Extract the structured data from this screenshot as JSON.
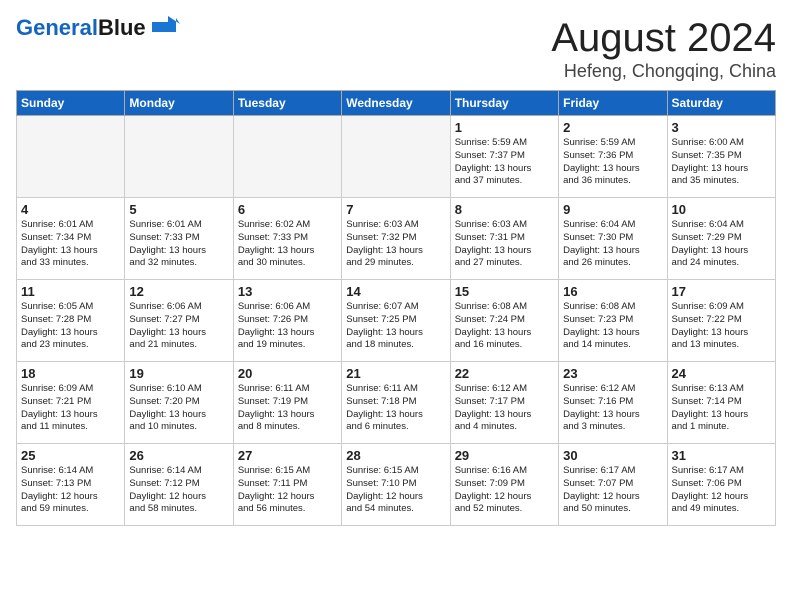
{
  "header": {
    "logo_line1": "General",
    "logo_line2": "Blue",
    "month": "August 2024",
    "location": "Hefeng, Chongqing, China"
  },
  "days_of_week": [
    "Sunday",
    "Monday",
    "Tuesday",
    "Wednesday",
    "Thursday",
    "Friday",
    "Saturday"
  ],
  "weeks": [
    [
      {
        "day": "",
        "content": ""
      },
      {
        "day": "",
        "content": ""
      },
      {
        "day": "",
        "content": ""
      },
      {
        "day": "",
        "content": ""
      },
      {
        "day": "1",
        "content": "Sunrise: 5:59 AM\nSunset: 7:37 PM\nDaylight: 13 hours\nand 37 minutes."
      },
      {
        "day": "2",
        "content": "Sunrise: 5:59 AM\nSunset: 7:36 PM\nDaylight: 13 hours\nand 36 minutes."
      },
      {
        "day": "3",
        "content": "Sunrise: 6:00 AM\nSunset: 7:35 PM\nDaylight: 13 hours\nand 35 minutes."
      }
    ],
    [
      {
        "day": "4",
        "content": "Sunrise: 6:01 AM\nSunset: 7:34 PM\nDaylight: 13 hours\nand 33 minutes."
      },
      {
        "day": "5",
        "content": "Sunrise: 6:01 AM\nSunset: 7:33 PM\nDaylight: 13 hours\nand 32 minutes."
      },
      {
        "day": "6",
        "content": "Sunrise: 6:02 AM\nSunset: 7:33 PM\nDaylight: 13 hours\nand 30 minutes."
      },
      {
        "day": "7",
        "content": "Sunrise: 6:03 AM\nSunset: 7:32 PM\nDaylight: 13 hours\nand 29 minutes."
      },
      {
        "day": "8",
        "content": "Sunrise: 6:03 AM\nSunset: 7:31 PM\nDaylight: 13 hours\nand 27 minutes."
      },
      {
        "day": "9",
        "content": "Sunrise: 6:04 AM\nSunset: 7:30 PM\nDaylight: 13 hours\nand 26 minutes."
      },
      {
        "day": "10",
        "content": "Sunrise: 6:04 AM\nSunset: 7:29 PM\nDaylight: 13 hours\nand 24 minutes."
      }
    ],
    [
      {
        "day": "11",
        "content": "Sunrise: 6:05 AM\nSunset: 7:28 PM\nDaylight: 13 hours\nand 23 minutes."
      },
      {
        "day": "12",
        "content": "Sunrise: 6:06 AM\nSunset: 7:27 PM\nDaylight: 13 hours\nand 21 minutes."
      },
      {
        "day": "13",
        "content": "Sunrise: 6:06 AM\nSunset: 7:26 PM\nDaylight: 13 hours\nand 19 minutes."
      },
      {
        "day": "14",
        "content": "Sunrise: 6:07 AM\nSunset: 7:25 PM\nDaylight: 13 hours\nand 18 minutes."
      },
      {
        "day": "15",
        "content": "Sunrise: 6:08 AM\nSunset: 7:24 PM\nDaylight: 13 hours\nand 16 minutes."
      },
      {
        "day": "16",
        "content": "Sunrise: 6:08 AM\nSunset: 7:23 PM\nDaylight: 13 hours\nand 14 minutes."
      },
      {
        "day": "17",
        "content": "Sunrise: 6:09 AM\nSunset: 7:22 PM\nDaylight: 13 hours\nand 13 minutes."
      }
    ],
    [
      {
        "day": "18",
        "content": "Sunrise: 6:09 AM\nSunset: 7:21 PM\nDaylight: 13 hours\nand 11 minutes."
      },
      {
        "day": "19",
        "content": "Sunrise: 6:10 AM\nSunset: 7:20 PM\nDaylight: 13 hours\nand 10 minutes."
      },
      {
        "day": "20",
        "content": "Sunrise: 6:11 AM\nSunset: 7:19 PM\nDaylight: 13 hours\nand 8 minutes."
      },
      {
        "day": "21",
        "content": "Sunrise: 6:11 AM\nSunset: 7:18 PM\nDaylight: 13 hours\nand 6 minutes."
      },
      {
        "day": "22",
        "content": "Sunrise: 6:12 AM\nSunset: 7:17 PM\nDaylight: 13 hours\nand 4 minutes."
      },
      {
        "day": "23",
        "content": "Sunrise: 6:12 AM\nSunset: 7:16 PM\nDaylight: 13 hours\nand 3 minutes."
      },
      {
        "day": "24",
        "content": "Sunrise: 6:13 AM\nSunset: 7:14 PM\nDaylight: 13 hours\nand 1 minute."
      }
    ],
    [
      {
        "day": "25",
        "content": "Sunrise: 6:14 AM\nSunset: 7:13 PM\nDaylight: 12 hours\nand 59 minutes."
      },
      {
        "day": "26",
        "content": "Sunrise: 6:14 AM\nSunset: 7:12 PM\nDaylight: 12 hours\nand 58 minutes."
      },
      {
        "day": "27",
        "content": "Sunrise: 6:15 AM\nSunset: 7:11 PM\nDaylight: 12 hours\nand 56 minutes."
      },
      {
        "day": "28",
        "content": "Sunrise: 6:15 AM\nSunset: 7:10 PM\nDaylight: 12 hours\nand 54 minutes."
      },
      {
        "day": "29",
        "content": "Sunrise: 6:16 AM\nSunset: 7:09 PM\nDaylight: 12 hours\nand 52 minutes."
      },
      {
        "day": "30",
        "content": "Sunrise: 6:17 AM\nSunset: 7:07 PM\nDaylight: 12 hours\nand 50 minutes."
      },
      {
        "day": "31",
        "content": "Sunrise: 6:17 AM\nSunset: 7:06 PM\nDaylight: 12 hours\nand 49 minutes."
      }
    ]
  ]
}
